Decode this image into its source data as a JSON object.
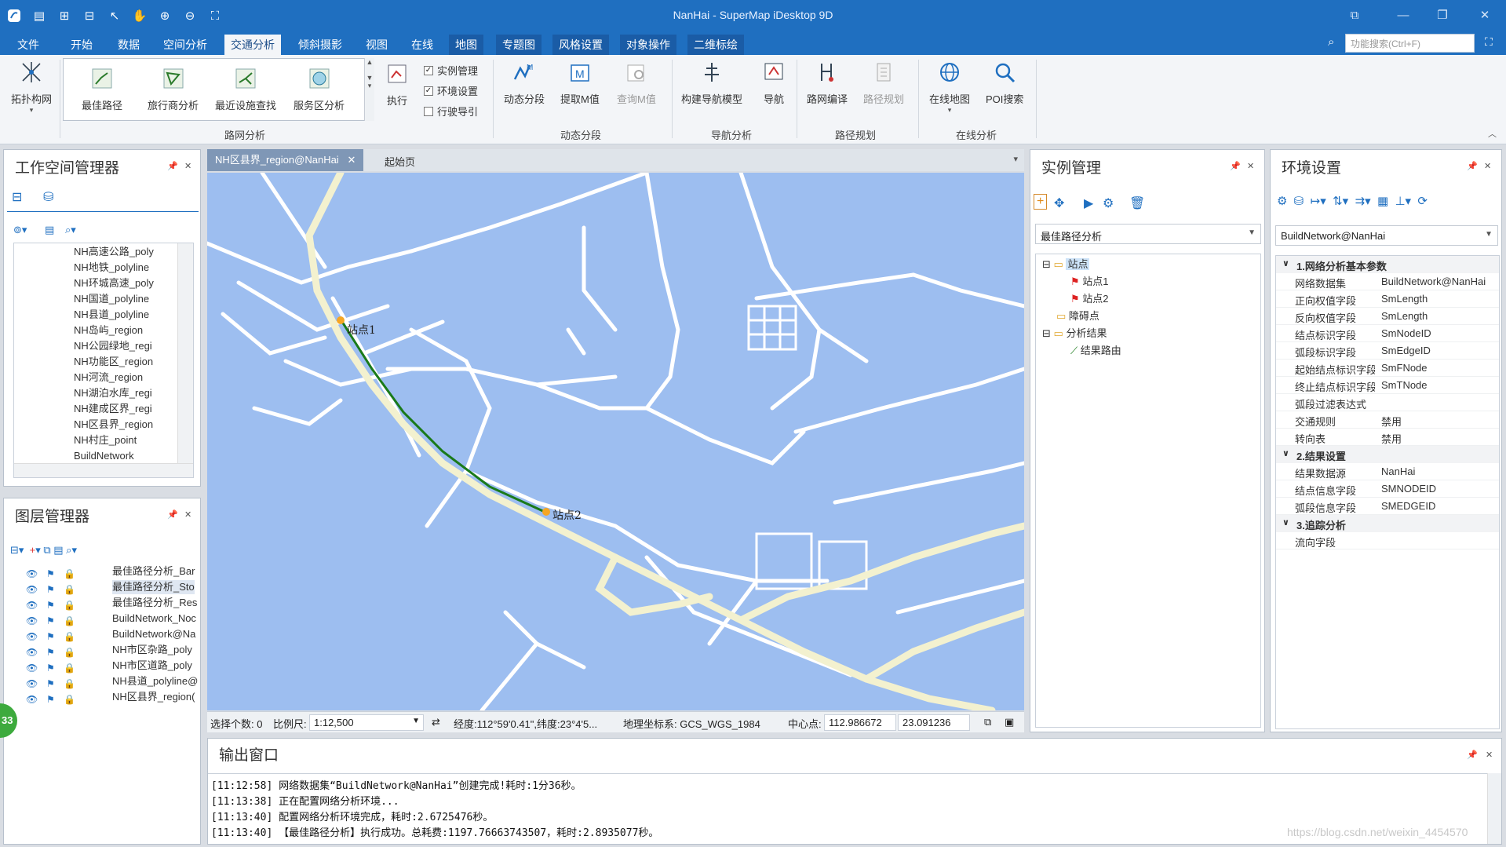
{
  "app": {
    "title": "NanHai - SuperMap iDesktop 9D",
    "quick_access": [
      "app-logo-icon",
      "save-icon",
      "new-window-icon",
      "open-window-icon",
      "select-icon",
      "pan-icon",
      "zoom-in-icon",
      "zoom-out-icon",
      "full-extent-icon"
    ]
  },
  "ribbon_tabs": [
    "文件",
    "开始",
    "数据",
    "空间分析",
    "交通分析",
    "倾斜摄影",
    "视图",
    "在线",
    "地图",
    "专题图",
    "风格设置",
    "对象操作",
    "二维标绘"
  ],
  "active_tab": "交通分析",
  "function_search": {
    "placeholder": "功能搜索(Ctrl+F)"
  },
  "ribbon": {
    "topology": "拓扑构网",
    "gallery": [
      "最佳路径",
      "旅行商分析",
      "最近设施查找",
      "服务区分析"
    ],
    "execute": "执行",
    "checkboxes": [
      {
        "label": "实例管理",
        "checked": "✓"
      },
      {
        "label": "环境设置",
        "checked": "✓"
      },
      {
        "label": "行驶导引",
        "checked": ""
      }
    ],
    "dynamic": [
      "动态分段",
      "提取M值",
      "查询M值"
    ],
    "navigation": [
      "构建导航模型",
      "导航"
    ],
    "path": [
      "路网编译",
      "路径规划"
    ],
    "online": [
      "在线地图",
      "POI搜索"
    ],
    "groups": [
      "路网分析",
      "动态分段",
      "导航分析",
      "路径规划",
      "在线分析"
    ]
  },
  "workspace": {
    "title": "工作空间管理器",
    "items": [
      "NH高速公路_poly",
      "NH地铁_polyline",
      "NH环城高速_poly",
      "NH国道_polyline",
      "NH县道_polyline",
      "NH岛屿_region",
      "NH公园绿地_regi",
      "NH功能区_region",
      "NH河流_region",
      "NH湖泊水库_regi",
      "NH建成区界_regi",
      "NH区县界_region",
      "NH村庄_point",
      "BuildNetwork"
    ]
  },
  "layers": {
    "title": "图层管理器",
    "items": [
      "最佳路径分析_Bar",
      "最佳路径分析_Sto",
      "最佳路径分析_Res",
      "BuildNetwork_Noc",
      "BuildNetwork@Na",
      "NH市区杂路_poly",
      "NH市区道路_poly",
      "NH县道_polyline@",
      "NH区县界_region("
    ]
  },
  "map": {
    "tab": "NH区县界_region@NanHai",
    "start_tab": "起始页",
    "station1": "站点1",
    "station2": "站点2"
  },
  "status": {
    "selected": "选择个数: 0",
    "scale_label": "比例尺:",
    "scale": "1:12,500",
    "coords": "经度:112°59'0.41\",纬度:23°4'5...",
    "crs": "地理坐标系: GCS_WGS_1984",
    "center_label": "中心点:",
    "center_x": "112.986672",
    "center_y": "23.091236"
  },
  "instance": {
    "title": "实例管理",
    "analysis": "最佳路径分析",
    "tree": {
      "stations": "站点",
      "s1": "站点1",
      "s2": "站点2",
      "barriers": "障碍点",
      "results": "分析结果",
      "route": "结果路由"
    }
  },
  "env": {
    "title": "环境设置",
    "dataset": "BuildNetwork@NanHai",
    "cat1": "1.网络分析基本参数",
    "cat2": "2.结果设置",
    "cat3": "3.追踪分析",
    "props1": [
      {
        "k": "网络数据集",
        "v": "BuildNetwork@NanHai"
      },
      {
        "k": "正向权值字段",
        "v": "SmLength"
      },
      {
        "k": "反向权值字段",
        "v": "SmLength"
      },
      {
        "k": "结点标识字段",
        "v": "SmNodeID"
      },
      {
        "k": "弧段标识字段",
        "v": "SmEdgeID"
      },
      {
        "k": "起始结点标识字段",
        "v": "SmFNode"
      },
      {
        "k": "终止结点标识字段",
        "v": "SmTNode"
      },
      {
        "k": "弧段过滤表达式",
        "v": ""
      },
      {
        "k": "交通规则",
        "v": "禁用"
      },
      {
        "k": "转向表",
        "v": "禁用"
      }
    ],
    "props2": [
      {
        "k": "结果数据源",
        "v": "NanHai"
      },
      {
        "k": "结点信息字段",
        "v": "SMNODEID"
      },
      {
        "k": "弧段信息字段",
        "v": "SMEDGEID"
      }
    ],
    "props3": [
      {
        "k": "流向字段",
        "v": ""
      }
    ]
  },
  "output": {
    "title": "输出窗口",
    "lines": [
      "[11:12:58] 网络数据集“BuildNetwork@NanHai”创建完成!耗时:1分36秒。",
      "[11:13:38] 正在配置网络分析环境...",
      "[11:13:40] 配置网络分析环境完成，耗时:2.6725476秒。",
      "[11:13:40] 【最佳路径分析】执行成功。总耗费:1197.76663743507，耗时:2.8935077秒。"
    ]
  },
  "badge": "33",
  "watermark": "https://blog.csdn.net/weixin_4454570"
}
